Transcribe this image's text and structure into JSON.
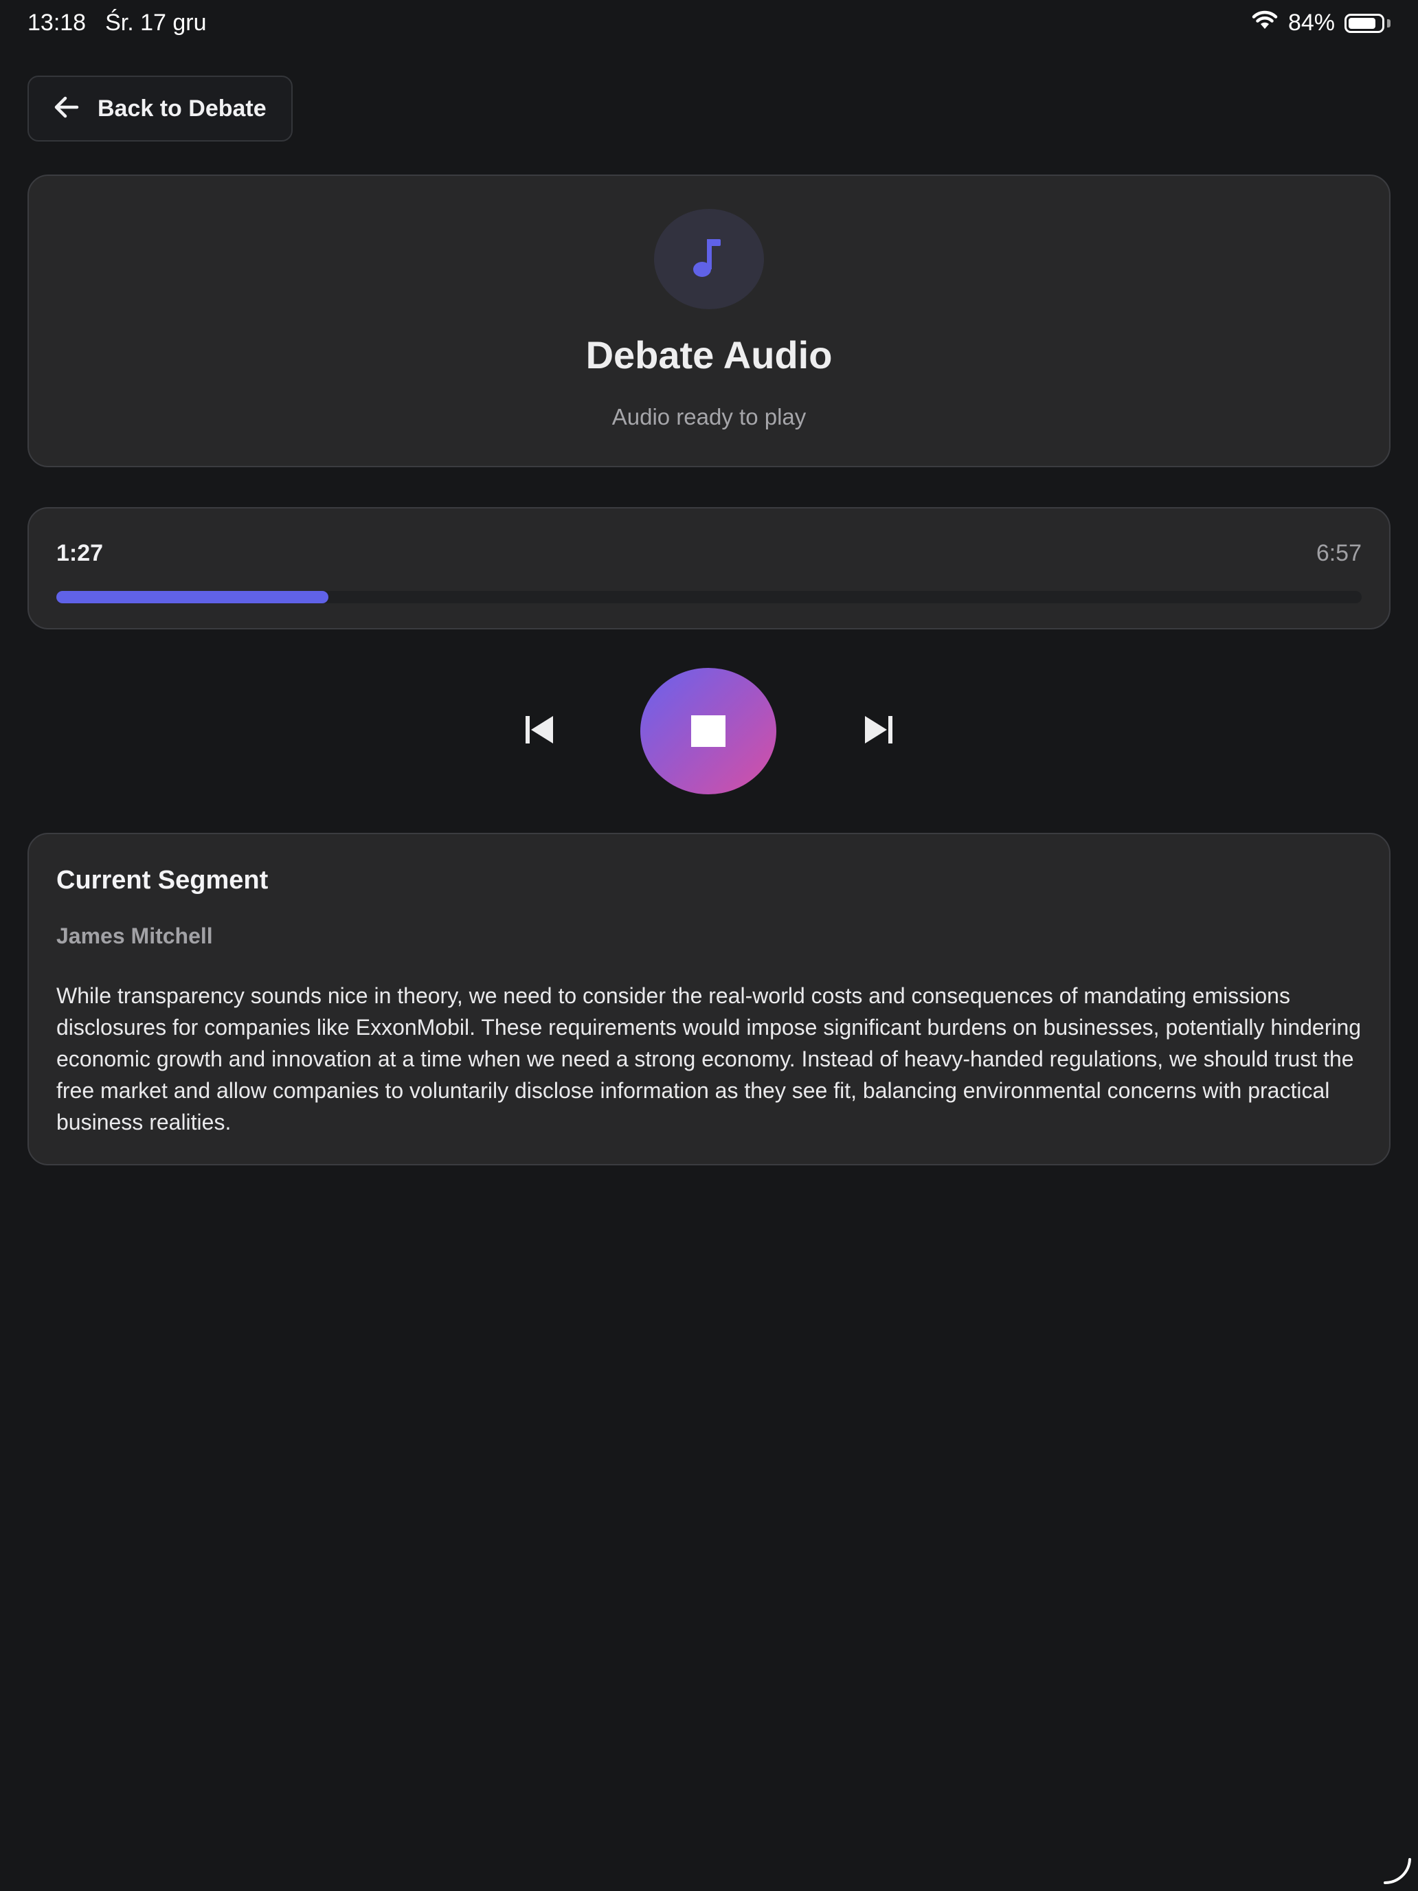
{
  "status_bar": {
    "time": "13:18",
    "date": "Śr. 17 gru",
    "battery_percent": "84%",
    "battery_level": 0.84,
    "icons": [
      "wifi-icon",
      "battery-icon"
    ]
  },
  "nav": {
    "back_label": "Back to Debate",
    "back_icon": "arrow-left-icon"
  },
  "header": {
    "icon": "music-note-icon",
    "title": "Debate Audio",
    "status": "Audio ready to play"
  },
  "player": {
    "current_time": "1:27",
    "total_time": "6:57",
    "progress_fraction": 0.2086,
    "controls": [
      "skip-previous-icon",
      "stop-icon",
      "skip-next-icon"
    ]
  },
  "segment": {
    "heading": "Current Segment",
    "speaker": "James Mitchell",
    "text": "While transparency sounds nice in theory, we need to consider the real-world costs and consequences of mandating emissions disclosures for companies like ExxonMobil. These requirements would impose significant burdens on businesses, potentially hindering economic growth and innovation at a time when we need a strong economy. Instead of heavy-handed regulations, we should trust the free market and allow companies to voluntarily disclose information as they see fit, balancing environmental concerns with practical business realities."
  },
  "colors": {
    "background": "#161719",
    "card": "#282829",
    "accent": "#6062e8",
    "gradient_start": "#6a62ec",
    "gradient_end": "#d64fa4"
  }
}
